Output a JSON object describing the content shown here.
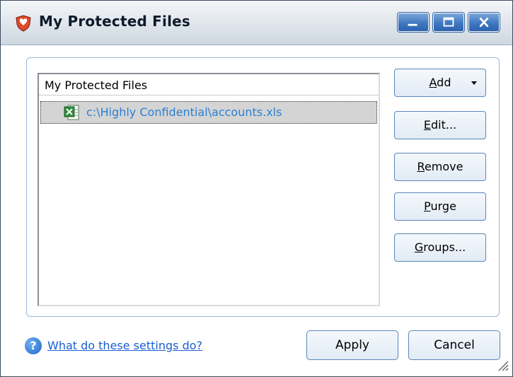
{
  "window": {
    "title": "My Protected Files",
    "icon": "shield-heart-icon"
  },
  "list": {
    "header": "My Protected Files",
    "items": [
      {
        "path": "c:\\Highly Confidential\\accounts.xls",
        "icon": "excel-file-icon"
      }
    ]
  },
  "buttons": {
    "add": {
      "u": "A",
      "rest": "dd"
    },
    "edit": {
      "u": "E",
      "rest": "dit..."
    },
    "remove": {
      "u": "R",
      "rest": "emove"
    },
    "purge": {
      "u": "P",
      "rest": "urge"
    },
    "groups": {
      "u": "G",
      "rest": "roups..."
    }
  },
  "footer": {
    "help_text": "What do these settings do?",
    "apply": "Apply",
    "cancel": "Cancel"
  },
  "colors": {
    "link": "#1a5fd1",
    "file_path": "#2b7fd4",
    "accent": "#3f78c2"
  }
}
